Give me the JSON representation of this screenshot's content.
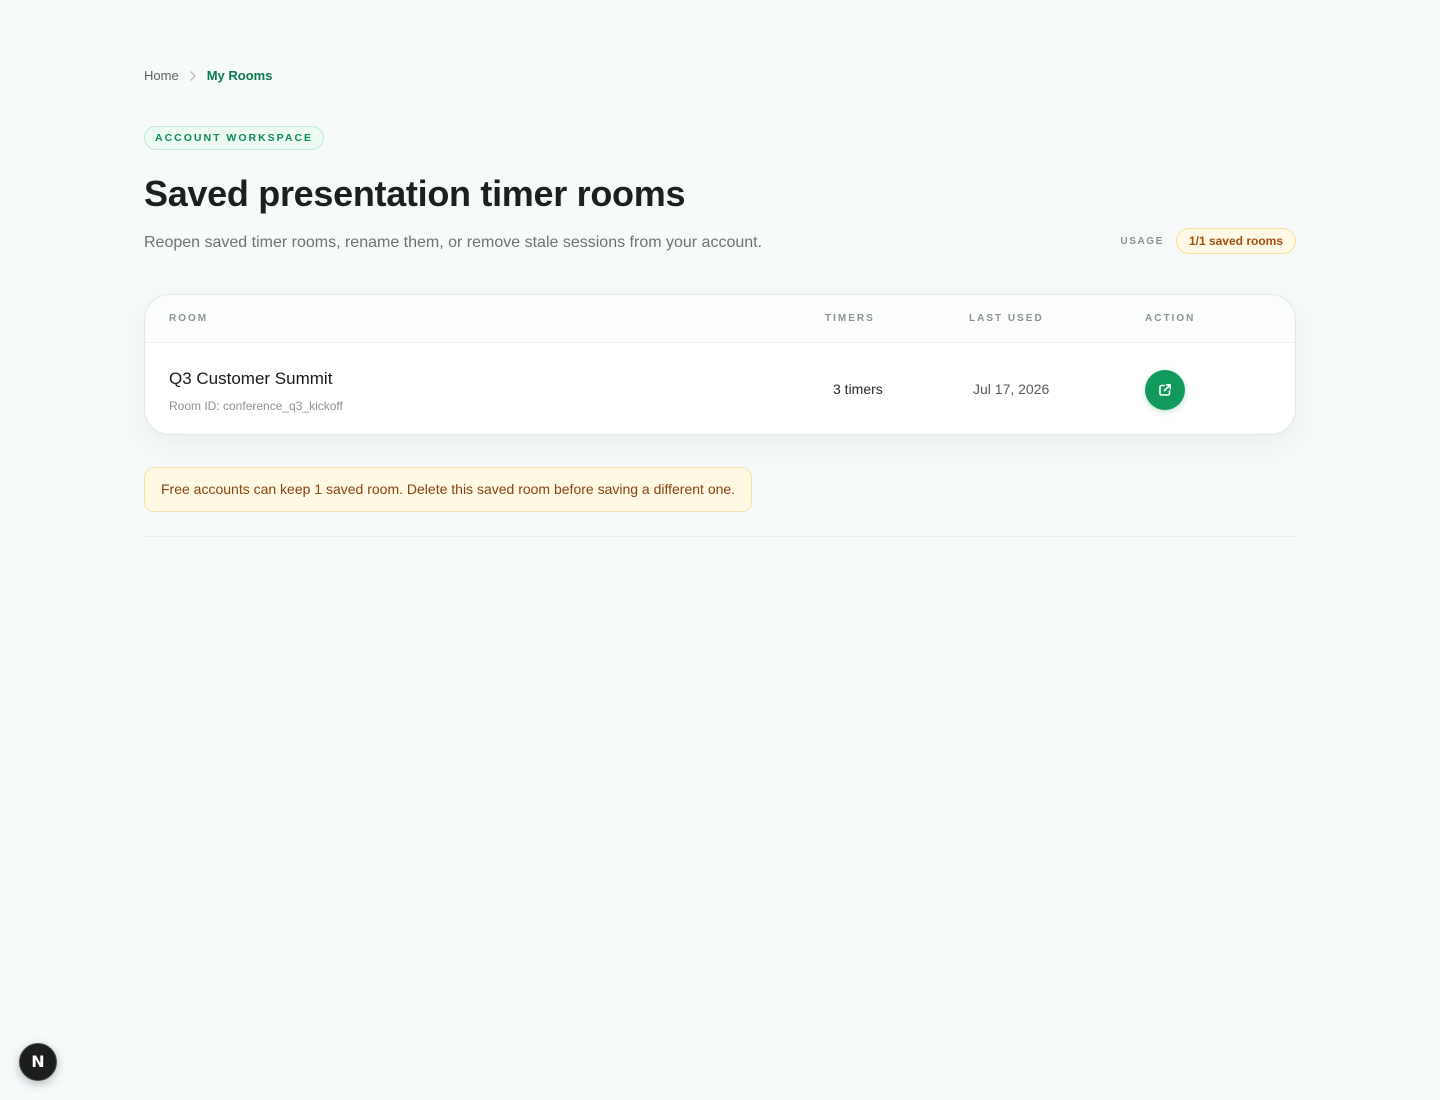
{
  "breadcrumb": {
    "home": "Home",
    "current": "My Rooms"
  },
  "eyebrow": "Account workspace",
  "title": "Saved presentation timer rooms",
  "subtitle": "Reopen saved timer rooms, rename them, or remove stale sessions from your account.",
  "usage": {
    "label": "Usage",
    "value": "1/1 saved rooms"
  },
  "table": {
    "headers": {
      "room": "Room",
      "timers": "Timers",
      "last_used": "Last used",
      "action": "Action"
    },
    "rows": [
      {
        "name": "Q3 Customer Summit",
        "room_id_label": "Room ID: conference_q3_kickoff",
        "timers": "3 timers",
        "last_used": "Jul 17, 2026",
        "action_icon": "external-link-icon"
      }
    ]
  },
  "notice": "Free accounts can keep 1 saved room. Delete this saved room before saving a different one.",
  "fab": {
    "letter": "N"
  },
  "colors": {
    "background": "#f6fafb",
    "accent": "#119a5c",
    "accent_text": "#0b7a4d",
    "warning_bg": "#fff8e3",
    "warning_text": "#8a4210"
  }
}
